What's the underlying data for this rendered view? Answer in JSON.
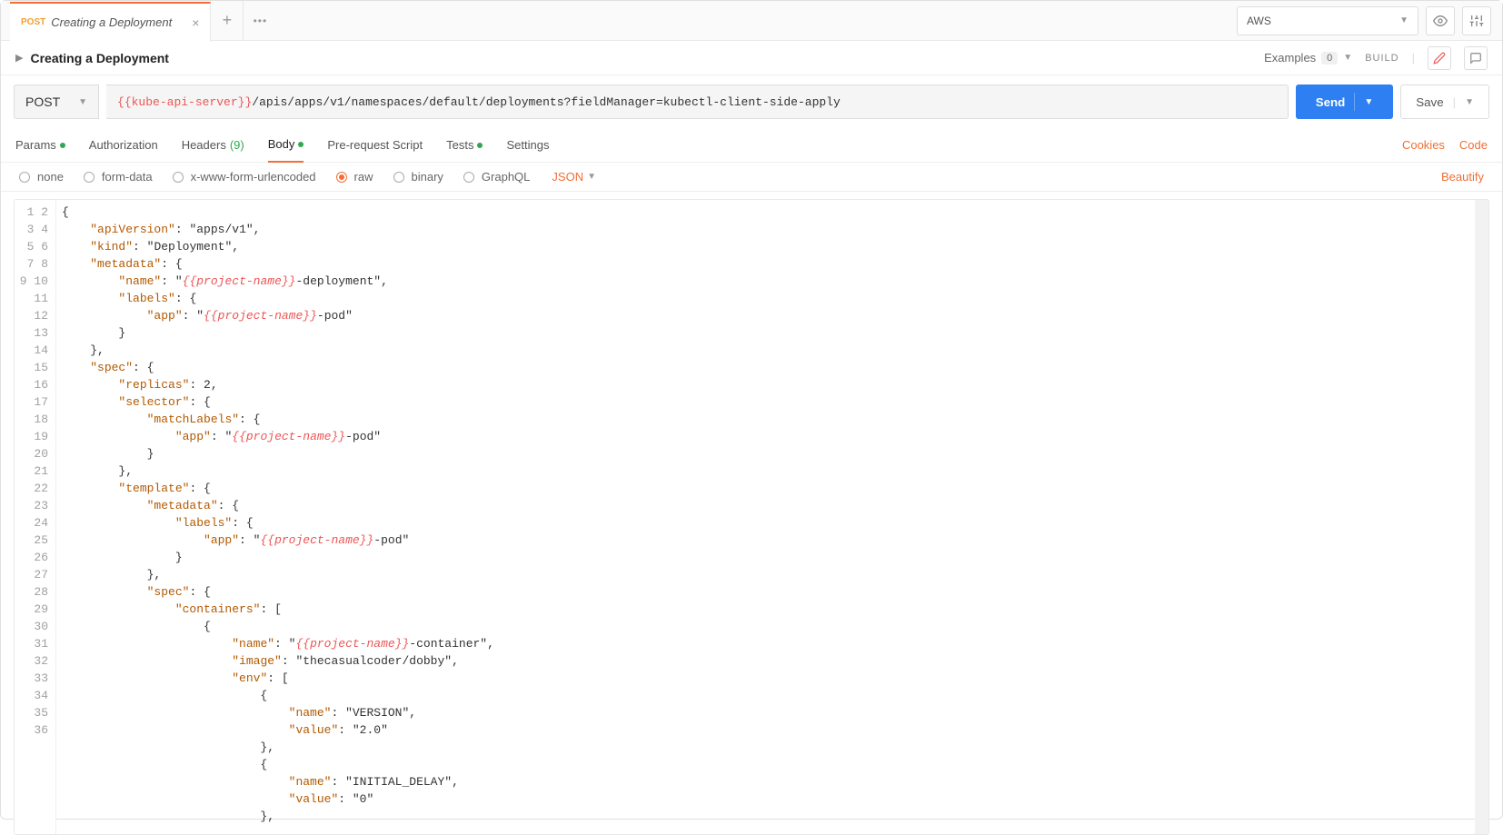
{
  "tab": {
    "method": "POST",
    "title": "Creating a Deployment"
  },
  "env": "AWS",
  "pageTitle": "Creating a Deployment",
  "examples": {
    "label": "Examples",
    "count": "0"
  },
  "build": "BUILD",
  "request": {
    "method": "POST",
    "urlVar": "{{kube-api-server}}",
    "urlPath": "/apis/apps/v1/namespaces/default/deployments?fieldManager=kubectl-client-side-apply",
    "send": "Send",
    "save": "Save"
  },
  "tabs2": {
    "params": "Params",
    "auth": "Authorization",
    "headers": "Headers",
    "headersCount": "(9)",
    "body": "Body",
    "prereq": "Pre-request Script",
    "tests": "Tests",
    "settings": "Settings",
    "cookies": "Cookies",
    "code": "Code"
  },
  "radios": {
    "none": "none",
    "formdata": "form-data",
    "xwww": "x-www-form-urlencoded",
    "raw": "raw",
    "binary": "binary",
    "graphql": "GraphQL",
    "lang": "JSON",
    "beautify": "Beautify"
  },
  "code": {
    "lines": [
      "{",
      "    \"apiVersion\": \"apps/v1\",",
      "    \"kind\": \"Deployment\",",
      "    \"metadata\": {",
      "        \"name\": \"{{project-name}}-deployment\",",
      "        \"labels\": {",
      "            \"app\": \"{{project-name}}-pod\"",
      "        }",
      "    },",
      "    \"spec\": {",
      "        \"replicas\": 2,",
      "        \"selector\": {",
      "            \"matchLabels\": {",
      "                \"app\": \"{{project-name}}-pod\"",
      "            }",
      "        },",
      "        \"template\": {",
      "            \"metadata\": {",
      "                \"labels\": {",
      "                    \"app\": \"{{project-name}}-pod\"",
      "                }",
      "            },",
      "            \"spec\": {",
      "                \"containers\": [",
      "                    {",
      "                        \"name\": \"{{project-name}}-container\",",
      "                        \"image\": \"thecasualcoder/dobby\",",
      "                        \"env\": [",
      "                            {",
      "                                \"name\": \"VERSION\",",
      "                                \"value\": \"2.0\"",
      "                            },",
      "                            {",
      "                                \"name\": \"INITIAL_DELAY\",",
      "                                \"value\": \"0\"",
      "                            },"
    ]
  }
}
